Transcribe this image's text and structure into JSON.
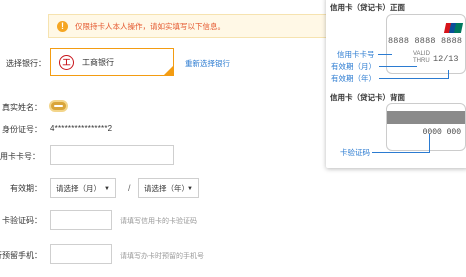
{
  "notice": {
    "icon": "warning-icon",
    "text": "仅限持卡人本人操作，请如实填写以下信息。"
  },
  "form": {
    "bank_label": "选择银行：",
    "bank_name": "工商银行",
    "bank_logo_glyph": "工",
    "reselect_link": "重新选择银行",
    "name_label": "真实姓名：",
    "id_label": "身份证号：",
    "id_value": "4****************2",
    "card_label": "信用卡卡号：",
    "expiry_label": "有效期：",
    "month_select": "请选择（月）",
    "year_select": "请选择（年）",
    "separator": "/",
    "cvv_label": "卡验证码：",
    "cvv_hint": "请填写信用卡的卡验证码",
    "phone_label": "行预留手机：",
    "phone_hint": "请填写办卡时预留的手机号"
  },
  "help_panel": {
    "front_title": "信用卡（贷记卡）正面",
    "back_title": "信用卡（贷记卡）背面",
    "card_number": "8888 8888 8888 8888",
    "valid_thru_line1": "VALID",
    "valid_thru_line2": "THRU",
    "expiry": "12/13",
    "cvv": "0000 000",
    "annotations": {
      "card_number": "信用卡卡号",
      "expiry_month": "有效期（月）",
      "expiry_year": "有效期（年）",
      "cvv": "卡验证码"
    },
    "colors": {
      "unionpay_red": "#d7141a",
      "unionpay_blue": "#0b4e9b",
      "unionpay_green": "#007a5e",
      "accent": "#f39c12",
      "link": "#2b7bd1"
    }
  }
}
